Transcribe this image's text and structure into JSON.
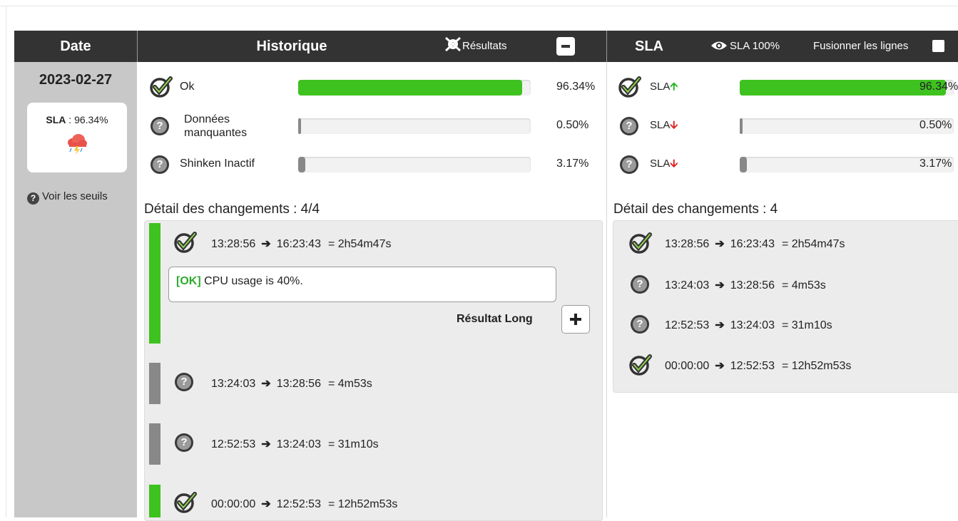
{
  "header": {
    "date": "Date",
    "historique": "Historique",
    "resultats": "Résultats",
    "sla": "SLA",
    "sla100": "SLA 100%",
    "fusionner": "Fusionner les lignes"
  },
  "date_col": {
    "date": "2023-02-27",
    "sla_label": "SLA",
    "sla_value": " : 96.34%",
    "seuils": "Voir les seuils"
  },
  "historique": {
    "rows": [
      {
        "label": "Ok",
        "pct": "96.34%",
        "value": 96.34,
        "status": "ok"
      },
      {
        "label": "Données manquantes",
        "pct": "0.50%",
        "value": 0.5,
        "status": "unknown"
      },
      {
        "label": "Shinken Inactif",
        "pct": "3.17%",
        "value": 3.17,
        "status": "unknown"
      }
    ],
    "detail_title": "Détail des changements : 4/4",
    "changes": [
      {
        "start": "13:28:56",
        "end": "16:23:43",
        "duration": "= 2h54m47s",
        "status": "ok"
      },
      {
        "start": "13:24:03",
        "end": "13:28:56",
        "duration": "= 4m53s",
        "status": "unknown"
      },
      {
        "start": "12:52:53",
        "end": "13:24:03",
        "duration": "= 31m10s",
        "status": "unknown"
      },
      {
        "start": "00:00:00",
        "end": "12:52:53",
        "duration": "= 12h52m53s",
        "status": "ok"
      }
    ],
    "output_tag": "[OK]",
    "output_text": " CPU usage is 40%.",
    "long_label": "Résultat Long"
  },
  "sla": {
    "rows": [
      {
        "label": "SLA",
        "pct": "96.34%",
        "value": 96.34,
        "trend": "up",
        "status": "ok"
      },
      {
        "label": "SLA",
        "pct": "0.50%",
        "value": 0.5,
        "trend": "down",
        "status": "unknown"
      },
      {
        "label": "SLA",
        "pct": "3.17%",
        "value": 3.17,
        "trend": "down",
        "status": "unknown"
      }
    ],
    "detail_title": "Détail des changements : 4",
    "changes": [
      {
        "start": "13:28:56",
        "end": "16:23:43",
        "duration": "= 2h54m47s",
        "status": "ok"
      },
      {
        "start": "13:24:03",
        "end": "13:28:56",
        "duration": "= 4m53s",
        "status": "unknown"
      },
      {
        "start": "12:52:53",
        "end": "13:24:03",
        "duration": "= 31m10s",
        "status": "unknown"
      },
      {
        "start": "00:00:00",
        "end": "12:52:53",
        "duration": "= 12h52m53s",
        "status": "ok"
      }
    ]
  },
  "colors": {
    "ok": "#3ec21f",
    "unknown": "#888888",
    "header": "#333333"
  }
}
